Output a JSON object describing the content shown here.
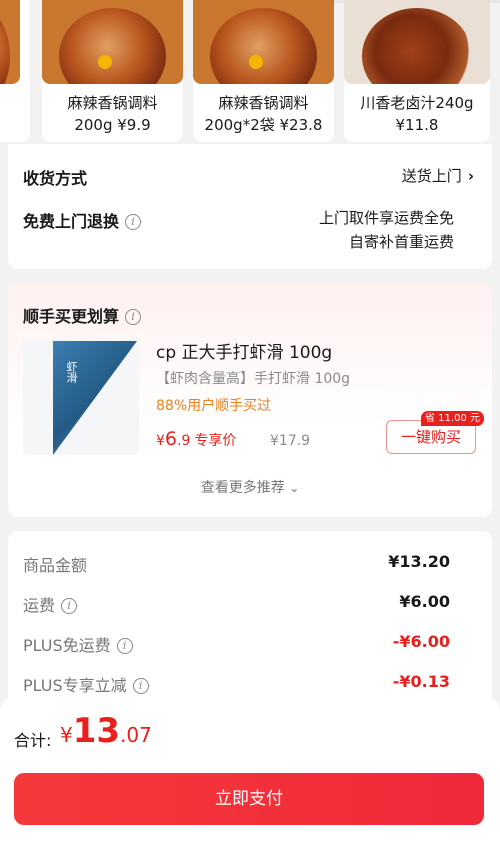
{
  "carousel": {
    "items": [
      {
        "name": "麻辣香锅调料",
        "spec_price": "200g ¥9.9"
      },
      {
        "name": "麻辣香锅调料",
        "spec_price": "200g*2袋 ¥23.8"
      },
      {
        "name": "川香老卤汁240g",
        "spec_price": "¥11.8"
      }
    ]
  },
  "delivery": {
    "method_label": "收货方式",
    "method_value": "送货上门",
    "return_label": "免费上门退换",
    "return_line1": "上门取件享运费全免",
    "return_line2": "自寄补首重运费"
  },
  "recommend": {
    "title": "顺手买更划算",
    "product_name": "cp 正大手打虾滑 100g",
    "product_sub": "【虾肉含量高】手打虾滑 100g",
    "rate": "88%用户顺手买过",
    "price_currency": "¥",
    "price_int": "6",
    "price_dec": ".9",
    "price_tag": "专享价",
    "orig_price": "¥17.9",
    "save_badge": "省 11.00 元",
    "buy_label": "一键购买",
    "more_label": "查看更多推荐"
  },
  "amount": {
    "rows": [
      {
        "label": "商品金额",
        "value": "¥13.20"
      },
      {
        "label": "运费",
        "value": "¥6.00"
      },
      {
        "label": "PLUS免运费",
        "value": "-¥6.00"
      },
      {
        "label": "PLUS专享立减",
        "value": "-¥0.13"
      }
    ]
  },
  "footer": {
    "total_label": "合计:",
    "total_currency": "¥",
    "total_int": "13",
    "total_dec": ".07",
    "pay_label": "立即支付"
  },
  "colors": {
    "accent_red": "#e8201e",
    "orange": "#e8821e",
    "pay_button": "#f5393b"
  }
}
